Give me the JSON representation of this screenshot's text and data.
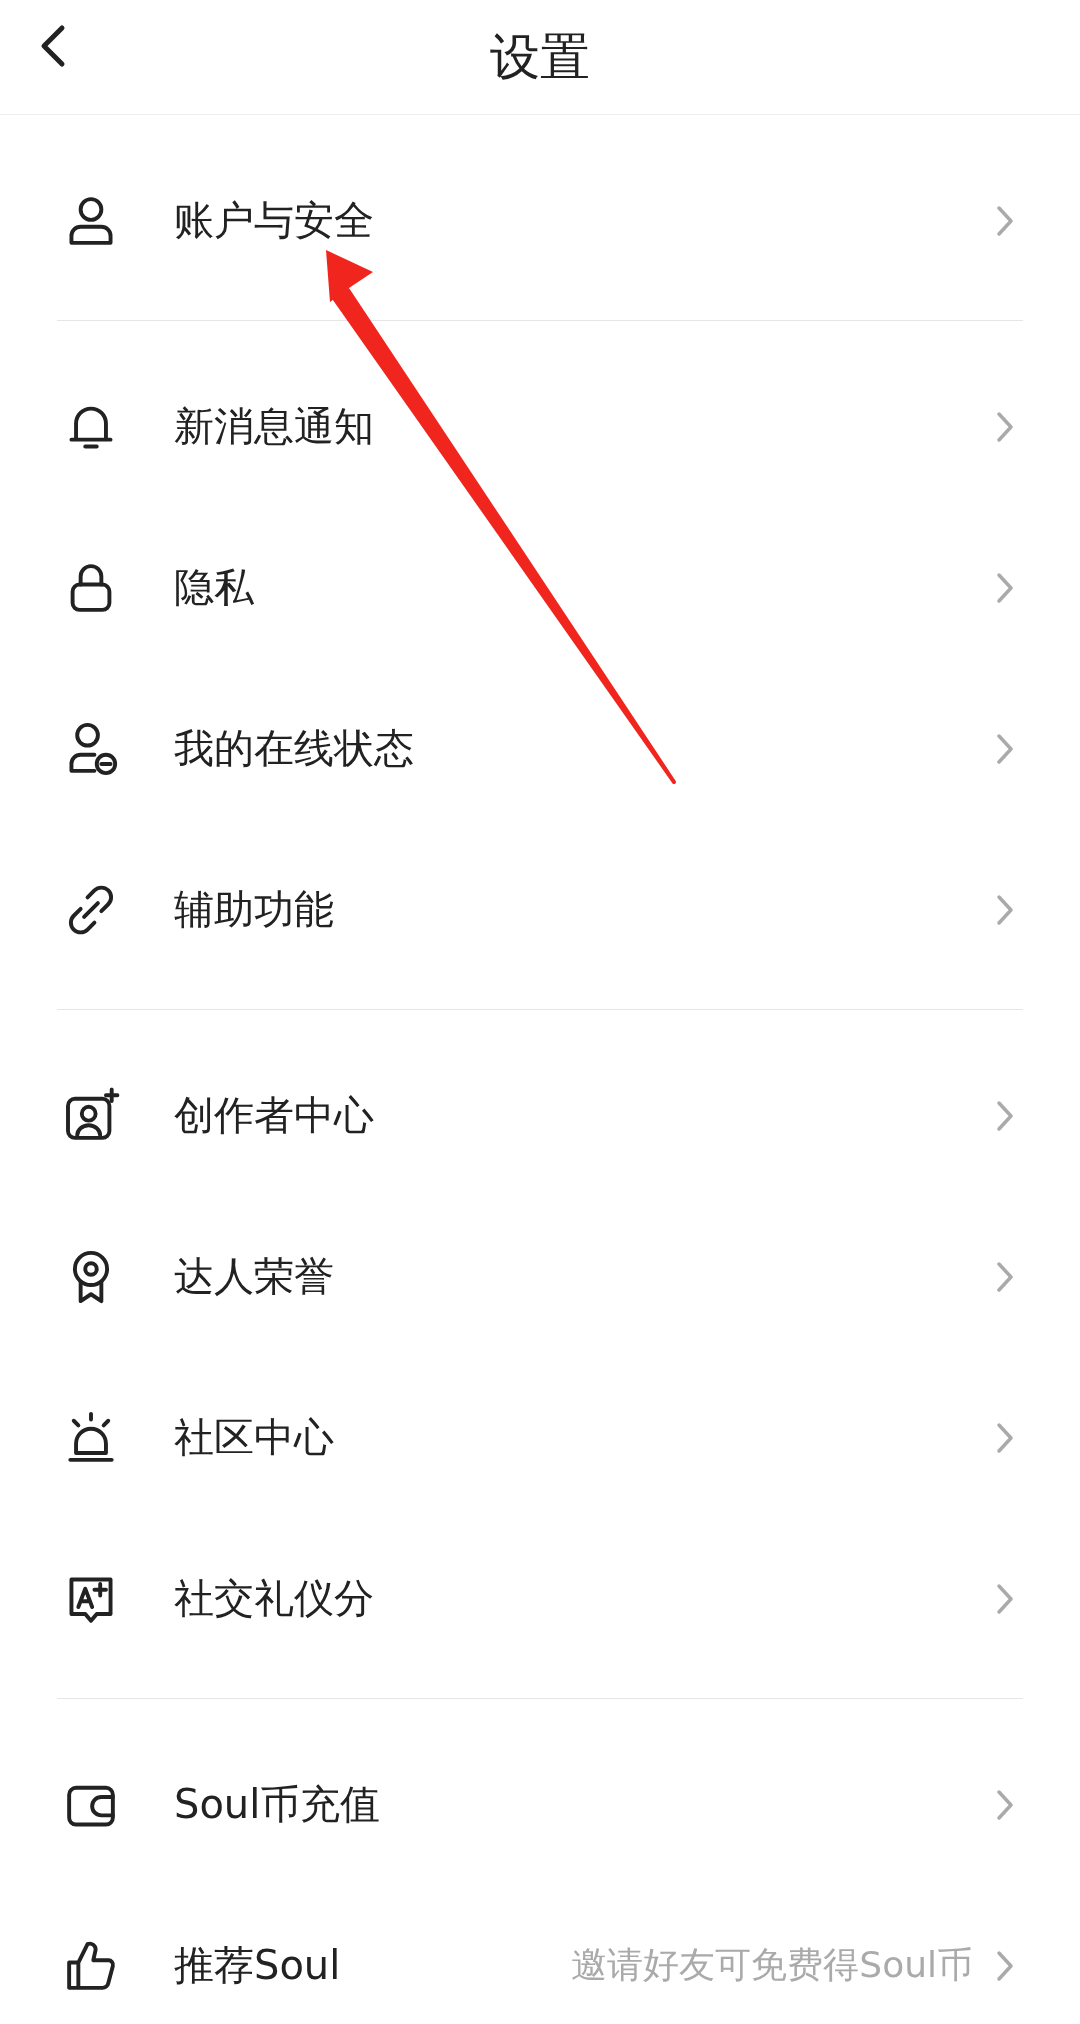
{
  "header": {
    "title": "设置"
  },
  "groups": [
    {
      "items": [
        {
          "label": "账户与安全"
        }
      ]
    },
    {
      "items": [
        {
          "label": "新消息通知"
        },
        {
          "label": "隐私"
        },
        {
          "label": "我的在线状态"
        },
        {
          "label": "辅助功能"
        }
      ]
    },
    {
      "items": [
        {
          "label": "创作者中心"
        },
        {
          "label": "达人荣誉"
        },
        {
          "label": "社区中心"
        },
        {
          "label": "社交礼仪分"
        }
      ]
    },
    {
      "items": [
        {
          "label": "Soul币充值"
        },
        {
          "label": "推荐Soul",
          "detail": "邀请好友可免费得Soul币"
        }
      ]
    }
  ]
}
